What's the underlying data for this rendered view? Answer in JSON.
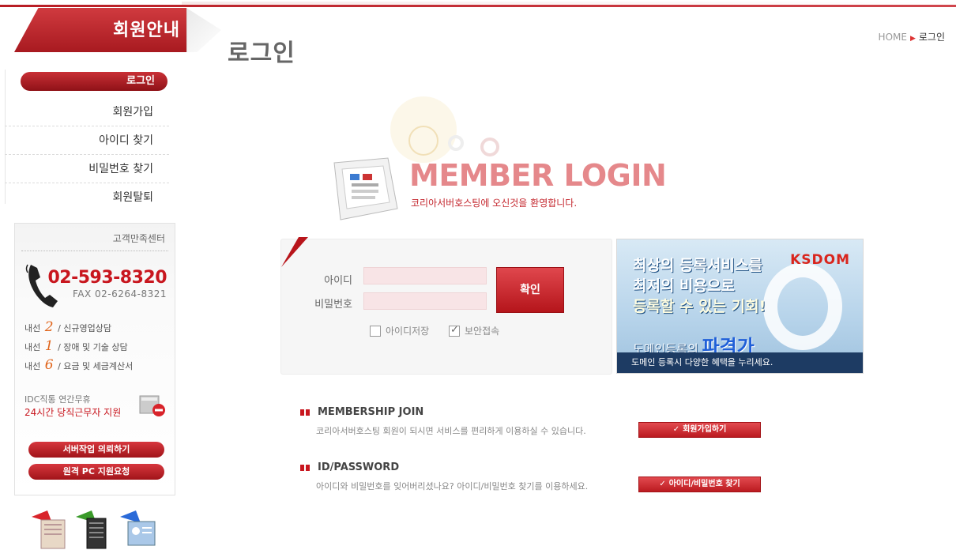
{
  "sidebar": {
    "title": "회원안내",
    "menu": [
      {
        "label": "로그인",
        "active": true
      },
      {
        "label": "회원가입"
      },
      {
        "label": "아이디 찾기"
      },
      {
        "label": "비밀번호 찾기"
      },
      {
        "label": "회원탈퇴"
      }
    ],
    "customer_center": {
      "title": "고객만족센터",
      "phone": "02-593-8320",
      "fax": "FAX 02-6264-8321",
      "lines": [
        {
          "prefix": "내선",
          "num": "2",
          "text": "/ 신규영업상담"
        },
        {
          "prefix": "내선",
          "num": "1",
          "text": "/ 장애 및 기술 상담"
        },
        {
          "prefix": "내선",
          "num": "6",
          "text": "/ 요금 및 세금계산서"
        }
      ],
      "idc_line1": "IDC직통 연간무휴",
      "idc_line2": "24시간 당직근무자 지원",
      "buttons": [
        "서버작업 의뢰하기",
        "원격 PC 지원요청"
      ]
    }
  },
  "header": {
    "page_title": "로그인",
    "breadcrumb_home": "HOME",
    "breadcrumb_current": "로그인"
  },
  "login": {
    "heading": "MEMBER LOGIN",
    "welcome": "코리아서버호스팅에 오신것을 환영합니다.",
    "id_label": "아이디",
    "pw_label": "비밀번호",
    "confirm_label": "확인",
    "save_id_label": "아이디저장",
    "secure_label": "보안접속"
  },
  "banner": {
    "line1": "최상의 등록서비스를",
    "line2": "최저의 비용으로",
    "line3": "등록할 수 있는 기회!",
    "line4_prefix": "도메인등록의",
    "line4_big": "파격가",
    "brand": "KSDOM",
    "footer": "도메인 등록시 다양한 혜택을 누리세요."
  },
  "membership": {
    "title": "MEMBERSHIP JOIN",
    "desc": "코리아서버호스팅 회원이 되시면 서비스를 편리하게 이용하실 수 있습니다.",
    "button": "회원가입하기"
  },
  "idpw": {
    "title": "ID/PASSWORD",
    "desc": "아이디와 비밀번호를 잊어버리셨나요? 아이디/비밀번호 찾기를 이용하세요.",
    "button": "아이디/비밀번호 찾기"
  },
  "colors": {
    "accent": "#c8161e",
    "title_pink": "#e5888b"
  }
}
